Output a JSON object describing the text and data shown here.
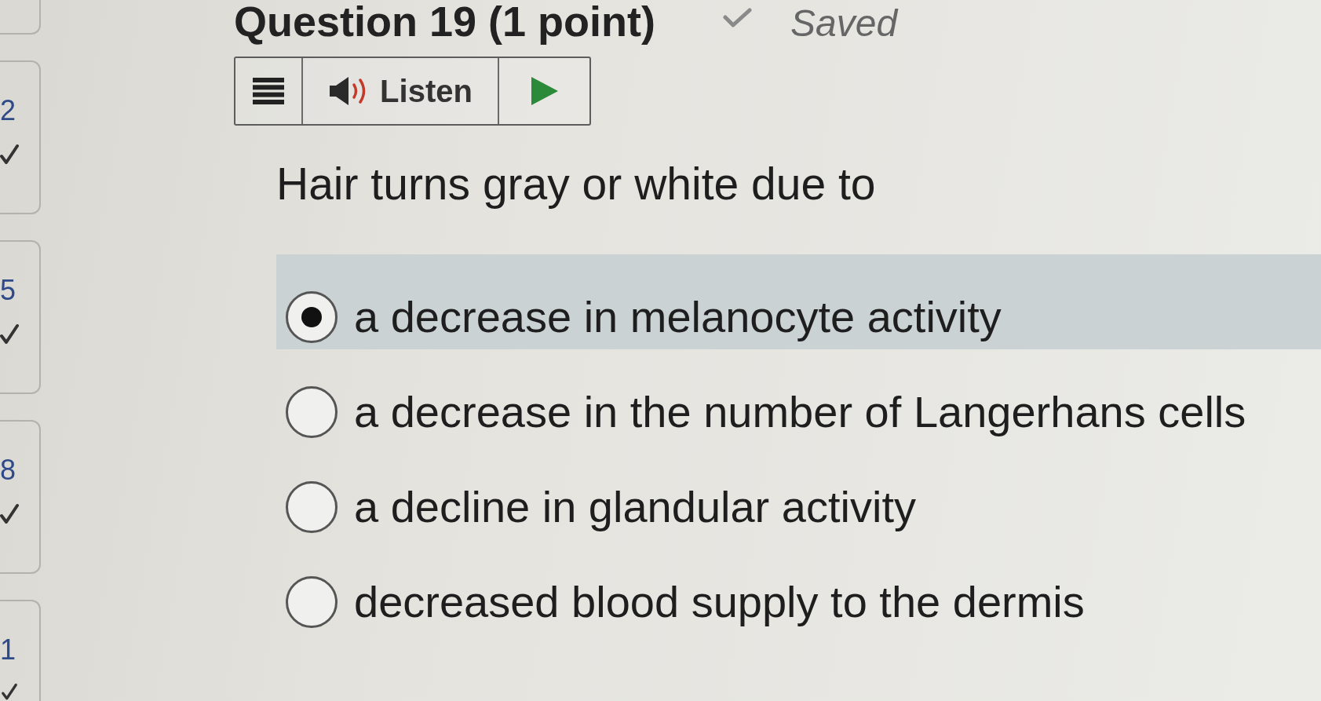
{
  "sidebar": {
    "items": [
      {
        "kind": "edge"
      },
      {
        "kind": "question",
        "number": "2",
        "answered": true
      },
      {
        "kind": "question",
        "number": "5",
        "answered": true
      },
      {
        "kind": "question",
        "number": "8",
        "answered": true
      },
      {
        "kind": "question",
        "number": "1",
        "answered": true
      }
    ]
  },
  "header": {
    "title": "Question 19 (1 point)",
    "saved": true,
    "status": "Saved"
  },
  "toolbar": {
    "listen_label": "Listen"
  },
  "question": {
    "prompt": "Hair turns gray or white due to",
    "options": [
      {
        "label": "a decrease in melanocyte activity",
        "selected": true
      },
      {
        "label": "a decrease in the number of Langerhans cells",
        "selected": false
      },
      {
        "label": "a decline in glandular activity",
        "selected": false
      },
      {
        "label": "decreased blood supply to the dermis",
        "selected": false
      }
    ]
  }
}
